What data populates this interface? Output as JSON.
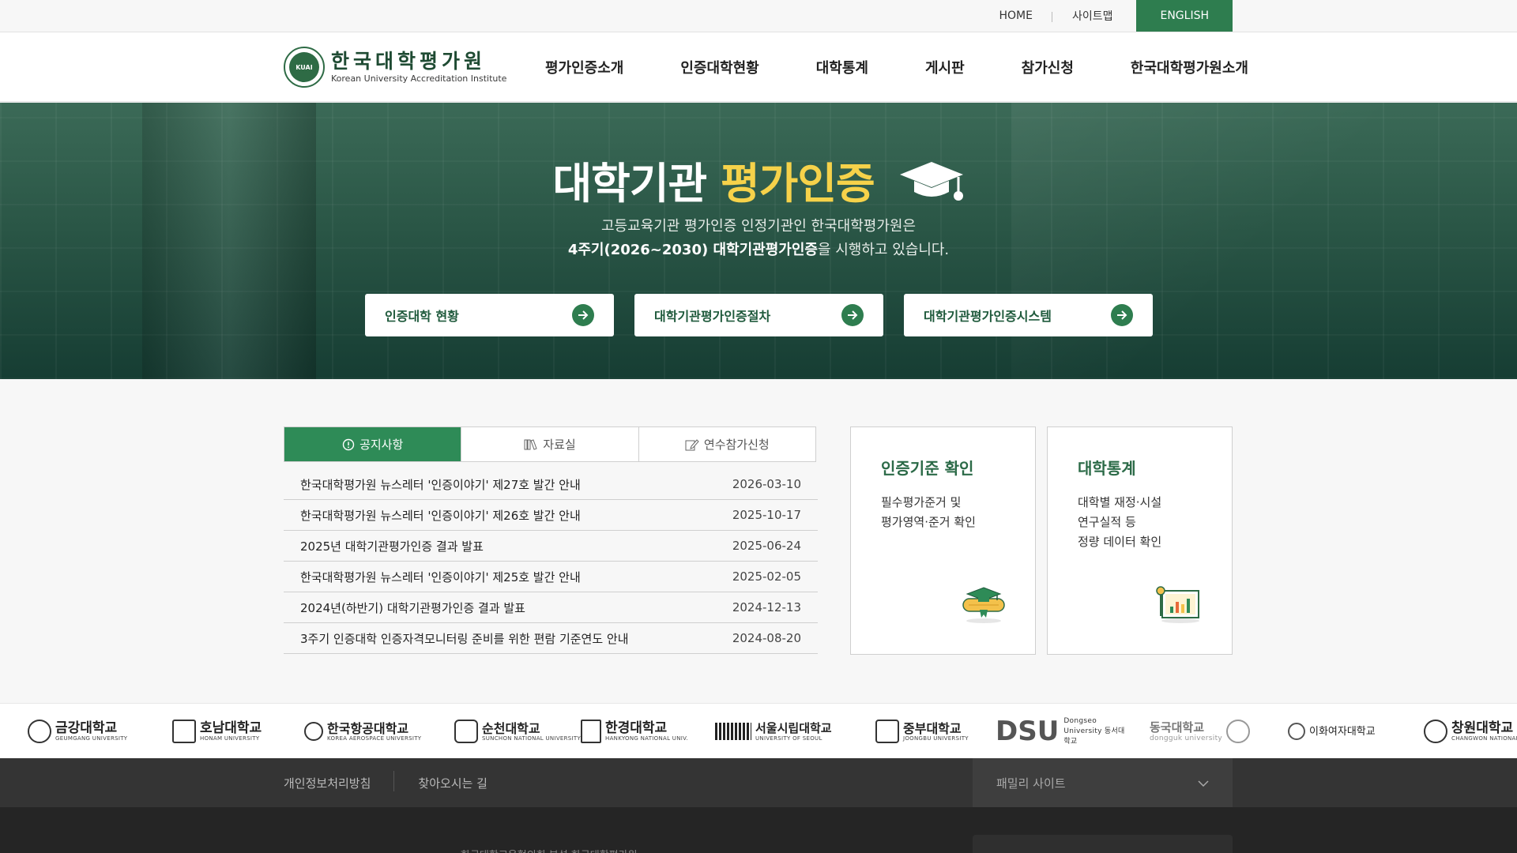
{
  "util": {
    "home": "HOME",
    "sitemap": "사이트맵",
    "english": "ENGLISH"
  },
  "header": {
    "logo_kr": "한국대학평가원",
    "logo_en": "Korean University Accreditation Institute",
    "logo_seal": "KUAI",
    "nav": [
      "평가인증소개",
      "인증대학현황",
      "대학통계",
      "게시판",
      "참가신청",
      "한국대학평가원소개"
    ]
  },
  "hero": {
    "title_main": "대학기관",
    "title_highlight": "평가인증",
    "desc_line1": "고등교육기관 평가인증 인정기관인 한국대학평가원은",
    "desc_bold": "4주기(2026~2030) 대학기관평가인증",
    "desc_tail": "을 시행하고 있습니다.",
    "buttons": [
      "인증대학 현황",
      "대학기관평가인증절차",
      "대학기관평가인증시스템"
    ],
    "accent": "#f6d24a"
  },
  "board": {
    "tabs": [
      "공지사항",
      "자료실",
      "연수참가신청"
    ],
    "items": [
      {
        "title": "한국대학평가원 뉴스레터 '인증이야기' 제27호 발간 안내",
        "date": "2026-03-10"
      },
      {
        "title": "한국대학평가원 뉴스레터 '인증이야기' 제26호 발간 안내",
        "date": "2025-10-17"
      },
      {
        "title": "2025년 대학기관평가인증 결과 발표",
        "date": "2025-06-24"
      },
      {
        "title": "한국대학평가원 뉴스레터 '인증이야기' 제25호 발간 안내",
        "date": "2025-02-05"
      },
      {
        "title": "2024년(하반기) 대학기관평가인증 결과 발표",
        "date": "2024-12-13"
      },
      {
        "title": "3주기 인증대학 인증자격모니터링 준비를 위한 편람 기준연도 안내",
        "date": "2024-08-20"
      }
    ]
  },
  "cards": {
    "criteria": {
      "title": "인증기준 확인",
      "line1": "필수평가준거 및",
      "line2": "평가영역·준거 확인",
      "icon": "diploma-cap-icon"
    },
    "stats": {
      "title": "대학통계",
      "line1": "대학별 재정·시설",
      "line2": "연구실적 등",
      "line3": "정량 데이터 확인",
      "icon": "chart-board-icon"
    }
  },
  "universities": [
    {
      "name": "금강대학교",
      "sub": "GEUMGANG UNIVERSITY"
    },
    {
      "name": "호남대학교",
      "sub": "HONAM UNIVERSITY"
    },
    {
      "name": "한국항공대학교",
      "sub": "KOREA AEROSPACE UNIVERSITY"
    },
    {
      "name": "순천대학교",
      "sub": "SUNCHON NATIONAL UNIVERSITY"
    },
    {
      "name": "한경대학교",
      "sub": "HANKYONG NATIONAL UNIV."
    },
    {
      "name": "서울시립대학교",
      "sub": "UNIVERSITY OF SEOUL"
    },
    {
      "name": "중부대학교",
      "sub": "JOONGBU UNIVERSITY"
    },
    {
      "name": "DSU",
      "sub": "Dongseo University 동서대학교"
    },
    {
      "name": "동국대학교",
      "sub": "dongguk university"
    },
    {
      "name": "이화여자대학교",
      "sub": ""
    },
    {
      "name": "창원대학교",
      "sub": "CHANGWON NATIONAL UNIVERSITY"
    }
  ],
  "footer": {
    "privacy": "개인정보처리방침",
    "directions": "찾아오시는 길",
    "family": "패밀리 사이트",
    "address": "한국대학교육협의회 부설 한국대학평가원"
  },
  "colors": {
    "brand_green": "#2e7d4f",
    "tab_active": "#2e8b57",
    "card_title": "#2b6a47"
  }
}
